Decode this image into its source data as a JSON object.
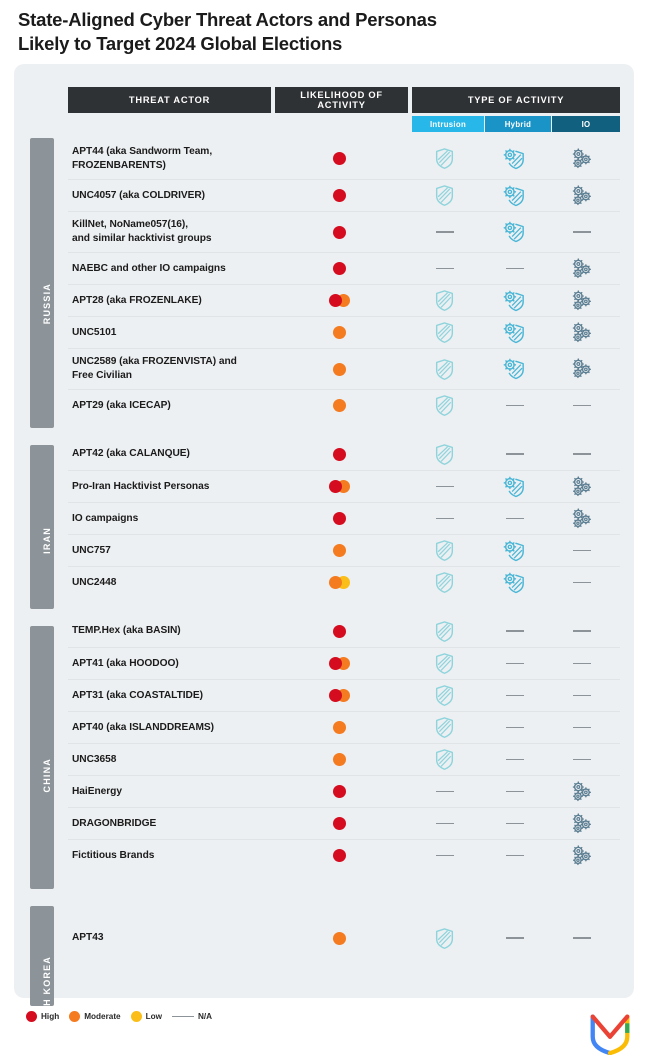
{
  "title": "State-Aligned Cyber Threat Actors and Personas\nLikely to Target 2024 Global Elections",
  "title_line1": "State-Aligned Cyber Threat Actors and Personas",
  "title_line2": "Likely to Target 2024 Global Elections",
  "headers": {
    "threat_actor": "THREAT ACTOR",
    "likelihood": "LIKELIHOOD OF ACTIVITY",
    "type_of_activity": "TYPE OF ACTIVITY",
    "intrusion": "Intrusion",
    "hybrid": "Hybrid",
    "io": "IO"
  },
  "colors": {
    "high": "#d50c1f",
    "moderate": "#f47b20",
    "low": "#fbbe18",
    "na": "#8d9499",
    "intrusion_header": "#27b7e8",
    "hybrid_header": "#1a93c6",
    "io_header": "#11607f",
    "header_bar": "#2f3234",
    "card_bg": "#edf0f2",
    "country_tab": "#8d9499"
  },
  "legend": {
    "items": [
      {
        "label": "High",
        "type": "dot",
        "color": "#d50c1f"
      },
      {
        "label": "Moderate",
        "type": "dot",
        "color": "#f47b20"
      },
      {
        "label": "Low",
        "type": "dot",
        "color": "#fbbe18"
      },
      {
        "label": "N/A",
        "type": "dash",
        "color": "#8d9499"
      }
    ]
  },
  "logo": {
    "name": "mandiant-logo"
  },
  "groups": [
    {
      "country": "RUSSIA",
      "rows": [
        {
          "actor": "APT44 (aka Sandworm Team,\nFROZENBARENTS)",
          "likelihood": [
            "high"
          ],
          "intrusion": "shield",
          "hybrid": "shield-gear",
          "io": "gears"
        },
        {
          "actor": "UNC4057 (aka COLDRIVER)",
          "likelihood": [
            "high"
          ],
          "intrusion": "shield",
          "hybrid": "shield-gear",
          "io": "gears"
        },
        {
          "actor": "KillNet, NoName057(16),\nand similar hacktivist groups",
          "likelihood": [
            "high"
          ],
          "intrusion": "na",
          "hybrid": "shield-gear",
          "io": "na"
        },
        {
          "actor": "NAEBC and other IO campaigns",
          "likelihood": [
            "high"
          ],
          "intrusion": "na",
          "hybrid": "na",
          "io": "gears"
        },
        {
          "actor": "APT28 (aka FROZENLAKE)",
          "likelihood": [
            "high",
            "moderate"
          ],
          "intrusion": "shield",
          "hybrid": "shield-gear",
          "io": "gears"
        },
        {
          "actor": "UNC5101",
          "likelihood": [
            "moderate"
          ],
          "intrusion": "shield",
          "hybrid": "shield-gear",
          "io": "gears"
        },
        {
          "actor": "UNC2589 (aka FROZENVISTA) and\nFree Civilian",
          "likelihood": [
            "moderate"
          ],
          "intrusion": "shield",
          "hybrid": "shield-gear",
          "io": "gears"
        },
        {
          "actor": "APT29 (aka ICECAP)",
          "likelihood": [
            "moderate"
          ],
          "intrusion": "shield",
          "hybrid": "na",
          "io": "na"
        }
      ]
    },
    {
      "country": "IRAN",
      "rows": [
        {
          "actor": "APT42 (aka CALANQUE)",
          "likelihood": [
            "high"
          ],
          "intrusion": "shield",
          "hybrid": "na",
          "io": "na"
        },
        {
          "actor": "Pro-Iran Hacktivist Personas",
          "likelihood": [
            "high",
            "moderate"
          ],
          "intrusion": "na",
          "hybrid": "shield-gear",
          "io": "gears"
        },
        {
          "actor": "IO campaigns",
          "likelihood": [
            "high"
          ],
          "intrusion": "na",
          "hybrid": "na",
          "io": "gears"
        },
        {
          "actor": "UNC757",
          "likelihood": [
            "moderate"
          ],
          "intrusion": "shield",
          "hybrid": "shield-gear",
          "io": "na"
        },
        {
          "actor": "UNC2448",
          "likelihood": [
            "moderate",
            "low"
          ],
          "intrusion": "shield",
          "hybrid": "shield-gear",
          "io": "na"
        }
      ]
    },
    {
      "country": "CHINA",
      "rows": [
        {
          "actor": "TEMP.Hex (aka BASIN)",
          "likelihood": [
            "high"
          ],
          "intrusion": "shield",
          "hybrid": "na",
          "io": "na"
        },
        {
          "actor": "APT41 (aka HOODOO)",
          "likelihood": [
            "high",
            "moderate"
          ],
          "intrusion": "shield",
          "hybrid": "na",
          "io": "na"
        },
        {
          "actor": "APT31 (aka COASTALTIDE)",
          "likelihood": [
            "high",
            "moderate"
          ],
          "intrusion": "shield",
          "hybrid": "na",
          "io": "na"
        },
        {
          "actor": "APT40 (aka ISLANDDREAMS)",
          "likelihood": [
            "moderate"
          ],
          "intrusion": "shield",
          "hybrid": "na",
          "io": "na"
        },
        {
          "actor": "UNC3658",
          "likelihood": [
            "moderate"
          ],
          "intrusion": "shield",
          "hybrid": "na",
          "io": "na"
        },
        {
          "actor": "HaiEnergy",
          "likelihood": [
            "high"
          ],
          "intrusion": "na",
          "hybrid": "na",
          "io": "gears"
        },
        {
          "actor": "DRAGONBRIDGE",
          "likelihood": [
            "high"
          ],
          "intrusion": "na",
          "hybrid": "na",
          "io": "gears"
        },
        {
          "actor": "Fictitious Brands",
          "likelihood": [
            "high"
          ],
          "intrusion": "na",
          "hybrid": "na",
          "io": "gears"
        }
      ]
    },
    {
      "country": "NORTH KOREA",
      "rows": [
        {
          "actor": "APT43",
          "likelihood": [
            "moderate"
          ],
          "intrusion": "shield",
          "hybrid": "na",
          "io": "na"
        }
      ]
    }
  ]
}
